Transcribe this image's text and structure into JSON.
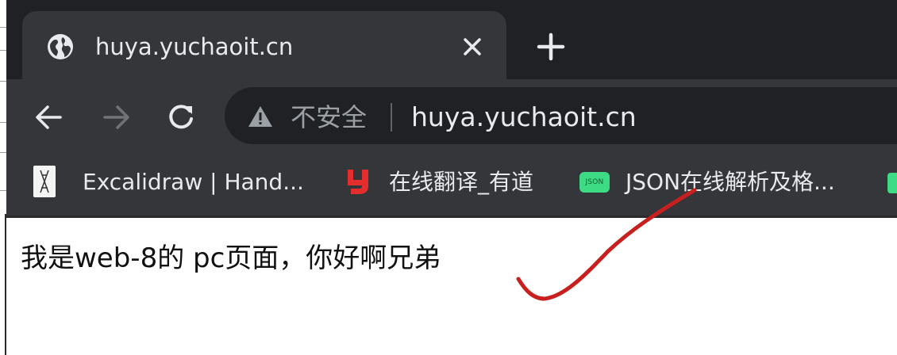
{
  "browser": {
    "tab": {
      "title": "huya.yuchaoit.cn",
      "favicon": "globe-icon",
      "close": "close-icon"
    },
    "new_tab": "plus-icon",
    "toolbar": {
      "back": "back-arrow-icon",
      "forward": "forward-arrow-icon",
      "reload": "reload-icon",
      "security_icon": "warning-triangle-icon",
      "security_label": "不安全",
      "url": "huya.yuchaoit.cn"
    },
    "bookmarks": [
      {
        "label": "Excalidraw | Hand...",
        "icon": "excalidraw-icon"
      },
      {
        "label": "在线翻译_有道",
        "icon": "youdao-icon",
        "icon_color": "#e42d2d"
      },
      {
        "label": "JSON在线解析及格...",
        "icon": "json-icon",
        "icon_text": "JSON",
        "icon_color": "#3ddc84"
      }
    ]
  },
  "page": {
    "text": "我是web-8的 pc页面，你好啊兄弟"
  },
  "annotation": {
    "type": "red-checkmark-stroke",
    "color": "#c8201e"
  },
  "colors": {
    "tabstrip": "#202124",
    "toolbar": "#35363a",
    "omnibox": "#202124",
    "text_light": "#e8eaed",
    "text_muted": "#9aa0a6"
  }
}
